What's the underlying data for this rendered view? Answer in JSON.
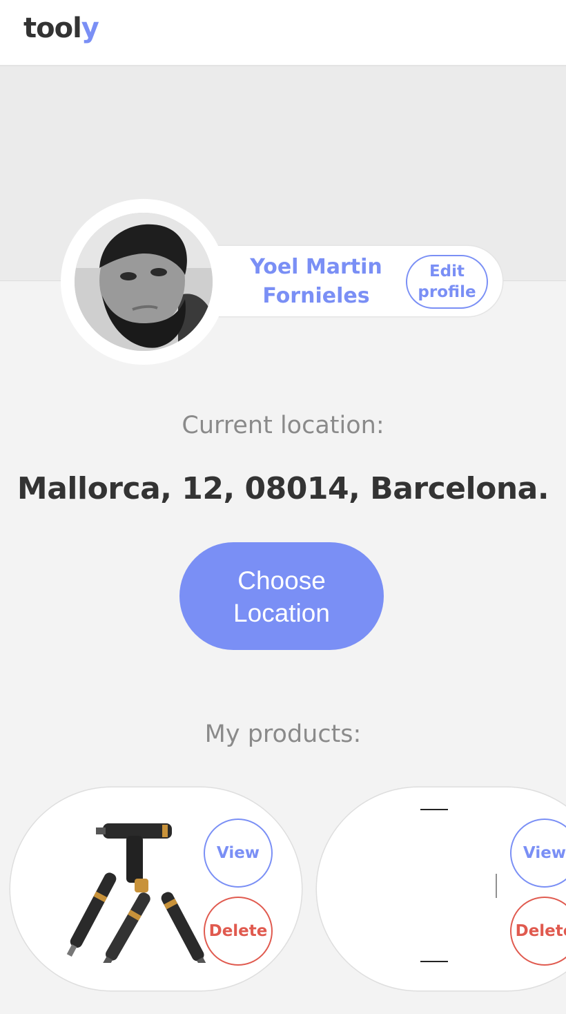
{
  "header": {
    "logo_main": "tool",
    "logo_accent": "y"
  },
  "profile": {
    "name": "Yoel Martin\nFornieles",
    "edit_label": "Edit\nprofile"
  },
  "location": {
    "label": "Current location:",
    "value": "Mallorca, 12, 08014, Barcelona.",
    "choose_label": "Choose\nLocation"
  },
  "products": {
    "label": "My products:",
    "items": [
      {
        "image": "power-tools-image",
        "view_label": "View",
        "delete_label": "Delete"
      },
      {
        "image": "product-image-blank",
        "view_label": "View",
        "delete_label": "Delete"
      }
    ]
  },
  "colors": {
    "accent": "#7a8ff5",
    "danger": "#e05a4f",
    "text_dark": "#333333",
    "text_muted": "#8a8a8a"
  }
}
